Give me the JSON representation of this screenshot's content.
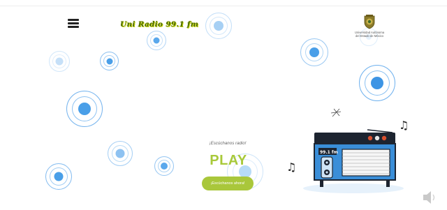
{
  "header": {
    "menu_icon": "hamburger-menu-icon",
    "brand_name": "Uni Radio 99.1 fm",
    "institution_lines": [
      "Universidad Autónoma",
      "del Estado de México"
    ],
    "seal_icon": "university-seal-icon"
  },
  "player": {
    "prompt": "¡Escúchanos radio!",
    "play_label": "PLAY",
    "button_label": "¡Escúchanos ahora!"
  },
  "radio": {
    "display": "99.1 fm",
    "icon": "vintage-radio-icon"
  },
  "decorations": {
    "note_icon": "music-note-icon",
    "speaker_icon": "speaker-volume-icon",
    "ring_color": "#4a9fe8",
    "ring_light_color": "#bcdcf7"
  },
  "colors": {
    "accent_green": "#a9c73b",
    "radio_body": "#1d2430",
    "radio_blue": "#3a8ed8",
    "background": "#ffffff"
  }
}
